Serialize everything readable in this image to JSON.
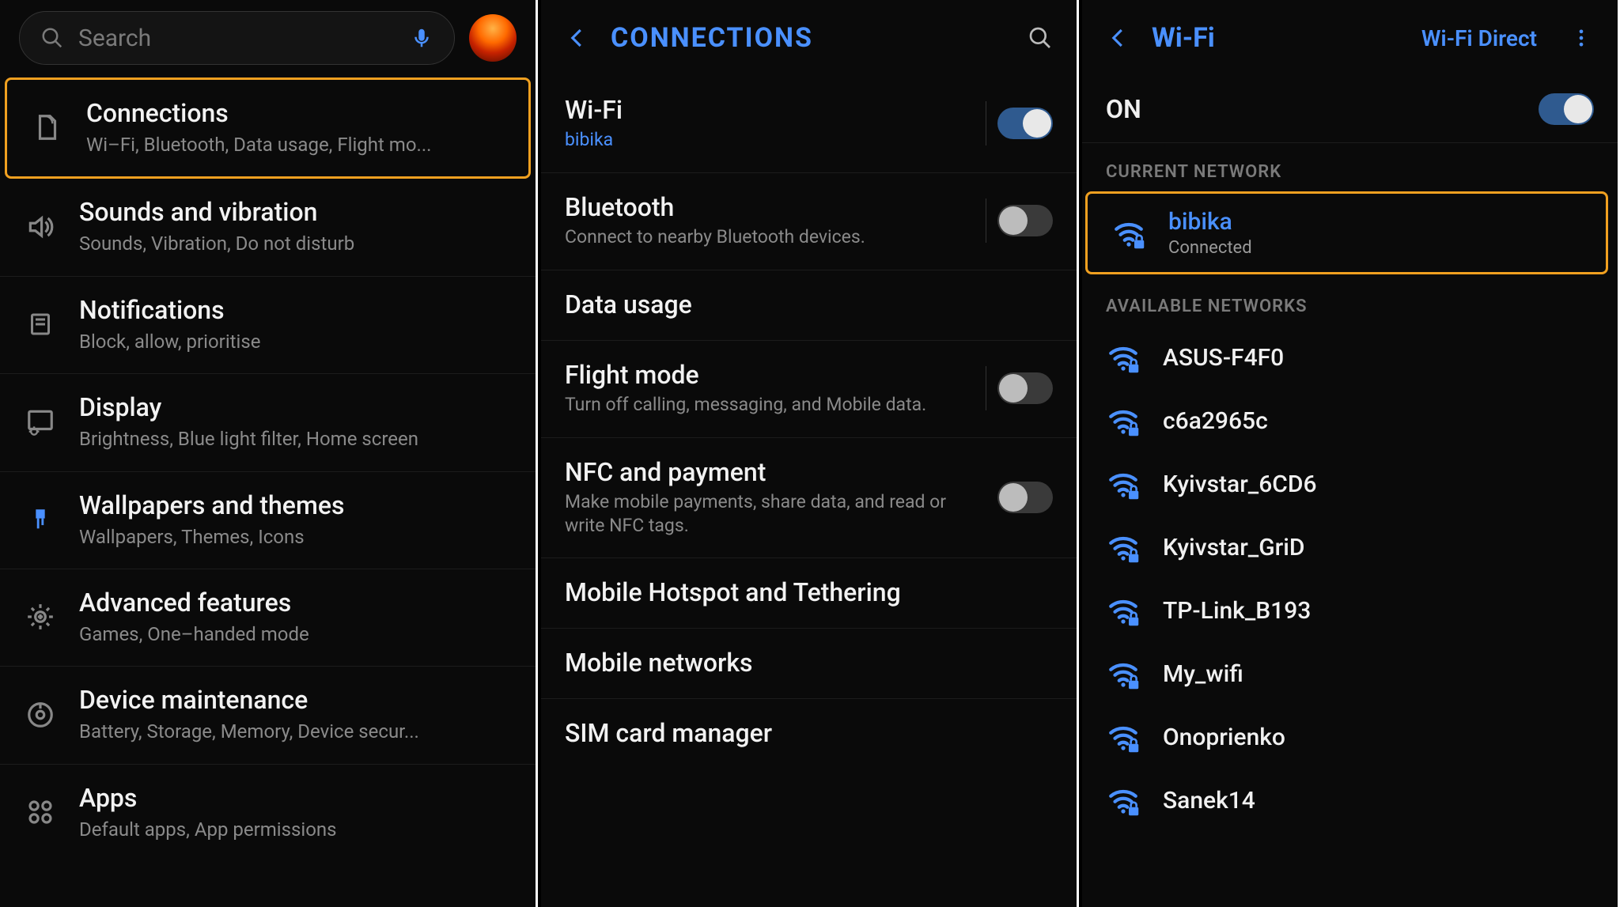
{
  "panel1": {
    "search_placeholder": "Search",
    "items": [
      {
        "title": "Connections",
        "sub": "Wi–Fi, Bluetooth, Data usage, Flight mo..."
      },
      {
        "title": "Sounds and vibration",
        "sub": "Sounds, Vibration, Do not disturb"
      },
      {
        "title": "Notifications",
        "sub": "Block, allow, prioritise"
      },
      {
        "title": "Display",
        "sub": "Brightness, Blue light filter, Home screen"
      },
      {
        "title": "Wallpapers and themes",
        "sub": "Wallpapers, Themes, Icons"
      },
      {
        "title": "Advanced features",
        "sub": "Games, One–handed mode"
      },
      {
        "title": "Device maintenance",
        "sub": "Battery, Storage, Memory, Device secur..."
      },
      {
        "title": "Apps",
        "sub": "Default apps, App permissions"
      }
    ]
  },
  "panel2": {
    "header": "CONNECTIONS",
    "items": [
      {
        "title": "Wi-Fi",
        "sub": "bibika",
        "sub_blue": true,
        "toggle": "on"
      },
      {
        "title": "Bluetooth",
        "sub": "Connect to nearby Bluetooth devices.",
        "toggle": "off"
      },
      {
        "title": "Data usage",
        "sub": "",
        "toggle": null
      },
      {
        "title": "Flight mode",
        "sub": "Turn off calling, messaging, and Mobile data.",
        "toggle": "off"
      },
      {
        "title": "NFC and payment",
        "sub": "Make mobile payments, share data, and read or write NFC tags.",
        "toggle": "off"
      },
      {
        "title": "Mobile Hotspot and Tethering",
        "sub": "",
        "toggle": null
      },
      {
        "title": "Mobile networks",
        "sub": "",
        "toggle": null
      },
      {
        "title": "SIM card manager",
        "sub": "",
        "toggle": null
      }
    ]
  },
  "panel3": {
    "header": "Wi-Fi",
    "right_action": "Wi-Fi Direct",
    "on_label": "ON",
    "section_current": "CURRENT NETWORK",
    "section_available": "AVAILABLE NETWORKS",
    "current": {
      "ssid": "bibika",
      "status": "Connected"
    },
    "available": [
      "ASUS-F4F0",
      "c6a2965c",
      "Kyivstar_6CD6",
      "Kyivstar_GriD",
      "TP-Link_B193",
      "My_wifi",
      "Onoprienko",
      "Sanek14"
    ]
  }
}
